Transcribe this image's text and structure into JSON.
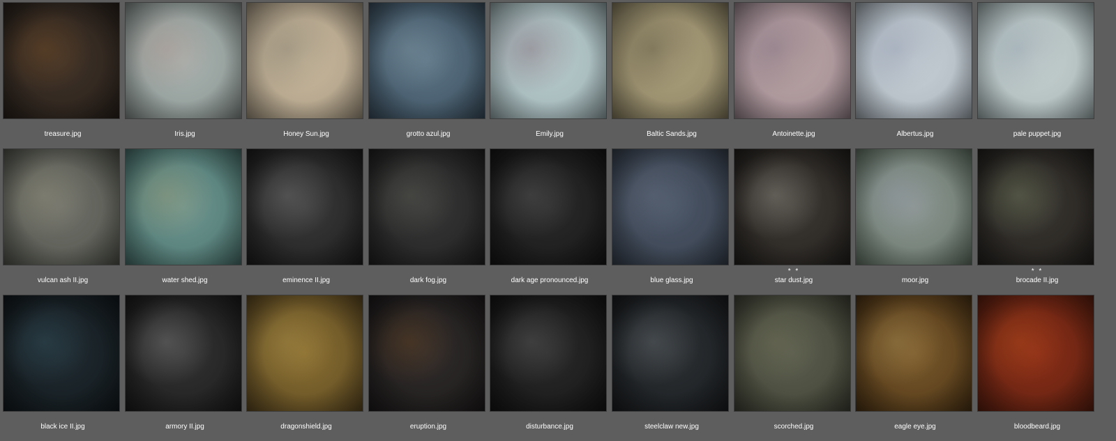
{
  "items": [
    {
      "name": "treasure.jpg",
      "rating": "",
      "colors": [
        "#3e3127",
        "#2a221c",
        "#8a5a2a"
      ]
    },
    {
      "name": "Iris.jpg",
      "rating": "",
      "colors": [
        "#a9b3b0",
        "#8a9491",
        "#b48e86"
      ]
    },
    {
      "name": "Honey Sun.jpg",
      "rating": "",
      "colors": [
        "#c9b99d",
        "#a89a84",
        "#6c6a60"
      ]
    },
    {
      "name": "grotto azul.jpg",
      "rating": "",
      "colors": [
        "#5d7585",
        "#3c5060",
        "#8aa0ad"
      ]
    },
    {
      "name": "Emily.jpg",
      "rating": "",
      "colors": [
        "#b7cacb",
        "#9fb2b5",
        "#6d4a5a"
      ]
    },
    {
      "name": "Baltic Sands.jpg",
      "rating": "",
      "colors": [
        "#aea37e",
        "#8a8062",
        "#3d362a"
      ]
    },
    {
      "name": "Antoinette.jpg",
      "rating": "",
      "colors": [
        "#b9a3a3",
        "#a08c94",
        "#6a5a70"
      ]
    },
    {
      "name": "Albertus.jpg",
      "rating": "",
      "colors": [
        "#c9d1d6",
        "#aab4bd",
        "#7b86a0"
      ]
    },
    {
      "name": "pale puppet.jpg",
      "rating": "",
      "colors": [
        "#c6d0cf",
        "#a9b7b8",
        "#7f8fa0"
      ]
    },
    {
      "name": "vulcan ash II.jpg",
      "rating": "",
      "colors": [
        "#6e6f68",
        "#55574f",
        "#a39f88"
      ]
    },
    {
      "name": "water shed.jpg",
      "rating": "",
      "colors": [
        "#6f9690",
        "#4c7570",
        "#a59a6d"
      ]
    },
    {
      "name": "eminence II.jpg",
      "rating": "",
      "colors": [
        "#3a3a3a",
        "#1f1f1f",
        "#8c8c8c"
      ]
    },
    {
      "name": "dark fog.jpg",
      "rating": "",
      "colors": [
        "#363636",
        "#222222",
        "#6b6b62"
      ]
    },
    {
      "name": "dark age pronounced.jpg",
      "rating": "",
      "colors": [
        "#2b2b2b",
        "#171717",
        "#6c6c6c"
      ]
    },
    {
      "name": "blue glass.jpg",
      "rating": "",
      "colors": [
        "#4a5566",
        "#39424f",
        "#6e7888"
      ]
    },
    {
      "name": "star dust.jpg",
      "rating": "* *",
      "colors": [
        "#3d3934",
        "#24211e",
        "#b5b1a8"
      ]
    },
    {
      "name": "moor.jpg",
      "rating": "",
      "colors": [
        "#8b9590",
        "#68776b",
        "#9ca0b2"
      ]
    },
    {
      "name": "brocade II.jpg",
      "rating": "* *",
      "colors": [
        "#383530",
        "#25221f",
        "#8c9a74"
      ]
    },
    {
      "name": "black ice II.jpg",
      "rating": "",
      "colors": [
        "#1f2a30",
        "#131a1e",
        "#3f6270"
      ]
    },
    {
      "name": "armory II.jpg",
      "rating": "",
      "colors": [
        "#333333",
        "#1c1c1c",
        "#9a9a9a"
      ]
    },
    {
      "name": "dragonshield.jpg",
      "rating": "",
      "colors": [
        "#8a6f32",
        "#5e4a22",
        "#b0954e"
      ]
    },
    {
      "name": "eruption.jpg",
      "rating": "",
      "colors": [
        "#2f2b2b",
        "#1e1b1b",
        "#7a4f22"
      ]
    },
    {
      "name": "disturbance.jpg",
      "rating": "",
      "colors": [
        "#2a2a2a",
        "#161616",
        "#707070"
      ]
    },
    {
      "name": "steelclaw new.jpg",
      "rating": "",
      "colors": [
        "#2c3033",
        "#1a1d20",
        "#7c8388"
      ]
    },
    {
      "name": "scorched.jpg",
      "rating": "",
      "colors": [
        "#5a5c4d",
        "#424437",
        "#7a7a5e"
      ]
    },
    {
      "name": "eagle eye.jpg",
      "rating": "",
      "colors": [
        "#7a5a2c",
        "#4e3516",
        "#b39a5e"
      ]
    },
    {
      "name": "bloodbeard.jpg",
      "rating": "",
      "colors": [
        "#8a2e18",
        "#5e2010",
        "#c0551e"
      ]
    }
  ]
}
